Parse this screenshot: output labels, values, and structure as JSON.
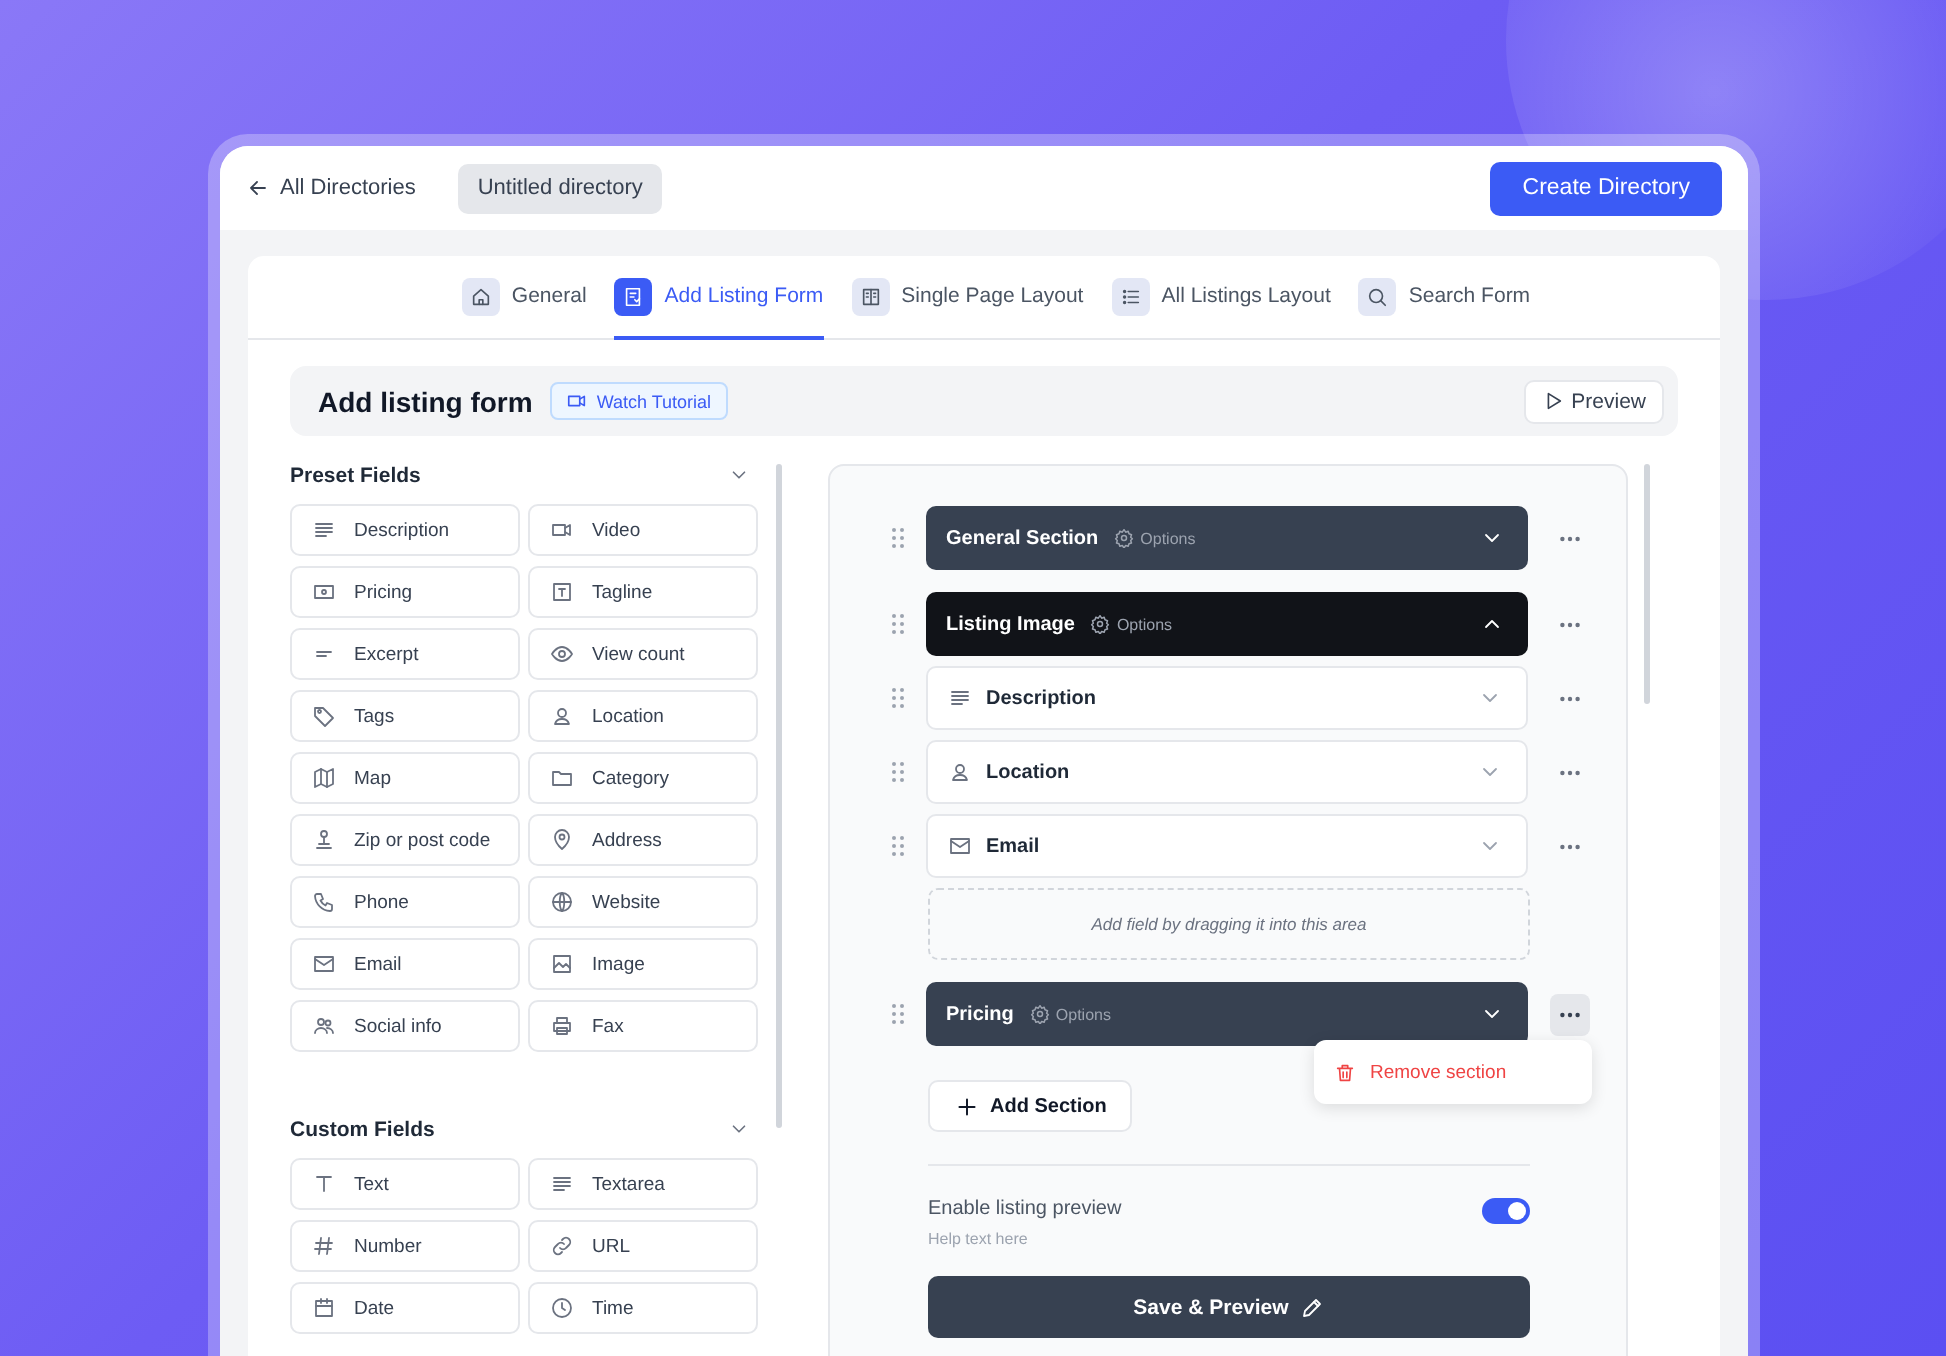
{
  "header": {
    "back_link": "All Directories",
    "directory_name": "Untitled directory",
    "primary_button": "Create Directory"
  },
  "tabs": [
    {
      "label": "General",
      "selected": false
    },
    {
      "label": "Add Listing Form",
      "selected": true
    },
    {
      "label": "Single Page Layout",
      "selected": false
    },
    {
      "label": "All Listings Layout",
      "selected": false
    },
    {
      "label": "Search Form",
      "selected": false
    }
  ],
  "form_header": {
    "title": "Add listing form",
    "tutorial_button": "Watch Tutorial",
    "preview_button": "Preview"
  },
  "preset_fields": {
    "title": "Preset Fields",
    "items": [
      "Description",
      "Video",
      "Pricing",
      "Tagline",
      "Excerpt",
      "View count",
      "Tags",
      "Location",
      "Map",
      "Category",
      "Zip or post code",
      "Address",
      "Phone",
      "Website",
      "Email",
      "Image",
      "Social info",
      "Fax"
    ]
  },
  "custom_fields": {
    "title": "Custom Fields",
    "items": [
      "Text",
      "Textarea",
      "Number",
      "URL",
      "Date",
      "Time"
    ]
  },
  "builder": {
    "sections": [
      {
        "label": "General Section",
        "options": "Options",
        "expanded": false,
        "menu_open": false
      },
      {
        "label": "Listing Image",
        "options": "Options",
        "expanded": true,
        "menu_open": false,
        "fields": [
          "Description",
          "Location",
          "Email"
        ],
        "dropzone": "Add field by dragging it into this area"
      },
      {
        "label": "Pricing",
        "options": "Options",
        "expanded": false,
        "menu_open": true
      }
    ],
    "section_menu": [
      "Remove section"
    ],
    "add_section_button": "Add Section",
    "preview_setting": {
      "label": "Enable listing preview",
      "help": "Help text here",
      "on": true
    },
    "save_button": "Save & Preview"
  }
}
